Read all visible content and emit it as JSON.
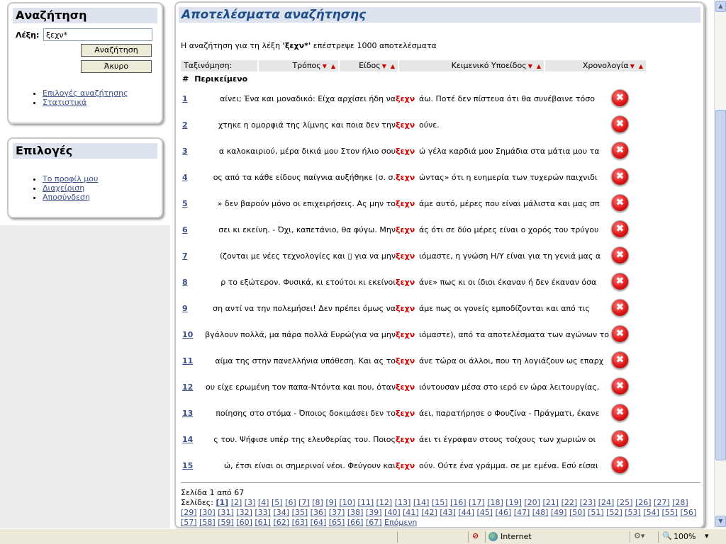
{
  "search_panel": {
    "title": "Αναζήτηση",
    "word_label": "Λέξη:",
    "word_value": "ξεχν*",
    "search_button": "Αναζήτηση",
    "cancel_button": "Άκυρο",
    "links": [
      "Επιλογές αναζήτησης",
      "Στατιστικά"
    ]
  },
  "options_panel": {
    "title": "Επιλογές",
    "links": [
      "Το προφίλ μου",
      "Διαχείριση",
      "Αποσύνδεση"
    ]
  },
  "results": {
    "title": "Αποτελέσματα αναζήτησης",
    "summary_prefix": "Η αναζήτηση για τη λέξη ",
    "summary_term": "'ξεχν*'",
    "summary_suffix": " επέστρεψε 1000 αποτελέσματα",
    "sort_label": "Ταξινόμηση:",
    "sort_columns": [
      "Τρόπος",
      "Είδος",
      "Κειμενικό Υποείδος",
      "Χρονολογία"
    ],
    "col_hash": "#",
    "col_context": "Περικείμενο",
    "keyword": "ξεχν",
    "rows": [
      {
        "n": "1",
        "left": "αίνει; Ένα και μοναδικό: Είχα αρχίσει ήδη να",
        "right": "άω. Ποτέ δεν πίστευα ότι θα συνέβαινε τόσο"
      },
      {
        "n": "2",
        "left": "χτηκε η ομορφιά της λίμνης και ποια δεν την",
        "right": "ούνε."
      },
      {
        "n": "3",
        "left": "α καλοκαιριού, μέρα δικιά μου Στον ήλιο σου",
        "right": "ώ γέλα καρδιά μου Σημάδια στα μάτια μου τα"
      },
      {
        "n": "4",
        "left": "ος από τα κάθε είδους παίγνια αυξήθηκε (σ. σ.",
        "right": "ώντας» ότι η ευημερία των τυχερών παιχνιδι"
      },
      {
        "n": "5",
        "left": "» δεν βαρούν μόνο οι επιχειρήσεις. Ας μην το",
        "right": "άμε αυτό, μέρες που είναι μάλιστα και μας σπ"
      },
      {
        "n": "6",
        "left": "σει κι εκείνη. - Όχι, καπετάνιο, θα φύγω. Μην",
        "right": "άς ότι σε δύο μέρες είναι ο χορός του τρύγου"
      },
      {
        "n": "7",
        "left": "ίζονται με νέες τεχνολογίες και ▯ για να μην",
        "right": "ιόμαστε, η γνώση Η/Υ είναι για τη γενιά μας α"
      },
      {
        "n": "8",
        "left": "ρ το εξώτερον. Φυσικά, κι ετούτοι κι εκείνοι",
        "right": "άνε» πως κι οι ίδιοι έκαναν ή δεν έκαναν όσα"
      },
      {
        "n": "9",
        "left": "ση αντί να την πολεμήσει! Δεν πρέπει όμως να",
        "right": "άμε πως οι γονείς εμποδίζονται και από τις"
      },
      {
        "n": "10",
        "left": "βγάλουν πολλά, μα πάρα πολλά Ευρώ(για να μην",
        "right": "ιόμαστε), από τα αποτελέσματα των αγώνων το"
      },
      {
        "n": "11",
        "left": "αίμα της στην πανελλήνια υπόθεση. Και ας το",
        "right": "άνε τώρα οι άλλοι, που τη λογιάζουν ως επαρχ"
      },
      {
        "n": "12",
        "left": "ου είχε ερωμένη τον παπα-Ντόντα και που, όταν",
        "right": "ιόντουσαν μέσα στο ιερό εν ώρα λειτουργίας,"
      },
      {
        "n": "13",
        "left": "ποίησης στο στόμα - Όποιος δοκιμάσει δεν το",
        "right": "άει, παρατήρησε ο Φουζίνα - Πράγματι, έκανε"
      },
      {
        "n": "14",
        "left": "ς του. Ψήφισε υπέρ της ελευθερίας του. Ποιος",
        "right": "άει τι έγραφαν στους τοίχους των χωριών οι"
      },
      {
        "n": "15",
        "left": "ώ, έτσι είναι οι σημερινοί νέοι. Φεύγουν και",
        "right": "ούν. Ούτε ένα γράμμα. σε με εμένα. Εσύ είσαι"
      }
    ]
  },
  "pager": {
    "page_text": "Σελίδα 1 από 67",
    "pages_label": "Σελίδες:",
    "current": "[1]",
    "next": "Επόμενη",
    "total_pages": 67
  },
  "status_bar": {
    "zone": "Internet",
    "zoom": "100%"
  }
}
